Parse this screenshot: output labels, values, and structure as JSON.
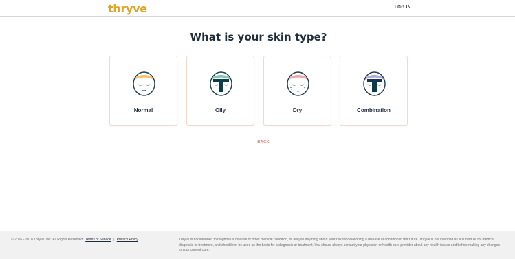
{
  "header": {
    "logo": "thryve",
    "login": "LOG IN"
  },
  "title": "What is your skin type?",
  "cards": [
    {
      "label": "Normal",
      "icon": "normal-skin-face-icon"
    },
    {
      "label": "Oily",
      "icon": "oily-skin-face-icon"
    },
    {
      "label": "Dry",
      "icon": "dry-skin-face-icon"
    },
    {
      "label": "Combination",
      "icon": "combination-skin-face-icon"
    }
  ],
  "back": {
    "label": "BACK",
    "icon": "arrow-left-icon"
  },
  "footer": {
    "copyright": "© 2016 - 2018 Thryve, Inc. All Rights Reserved",
    "terms": "Terms of Service",
    "separator": "|",
    "privacy": "Privacy Policy",
    "disclaimer": "Thryve is not intended to diagnose a disease or other medical condition, or tell you anything about your risk for developing a disease or condition in the future. Thryve is not intended as a substitute for medical diagnosis or treatment, and should not be used as the basis for a diagnosis or treatment. You should always consult your physician or health care provider about any health issues and before making any changes to your current care."
  },
  "colors": {
    "brand": "#e0a526",
    "accent": "#e07b6a",
    "text": "#1f2d3d",
    "face_outline": "#1f3b4d",
    "oily_tzone": "#0e3a4a",
    "normal_hair": "#f3c26b",
    "oily_hair": "#7fc6b5",
    "dry_hair": "#f2a7a7",
    "combination_hair": "#b8a6e0"
  }
}
